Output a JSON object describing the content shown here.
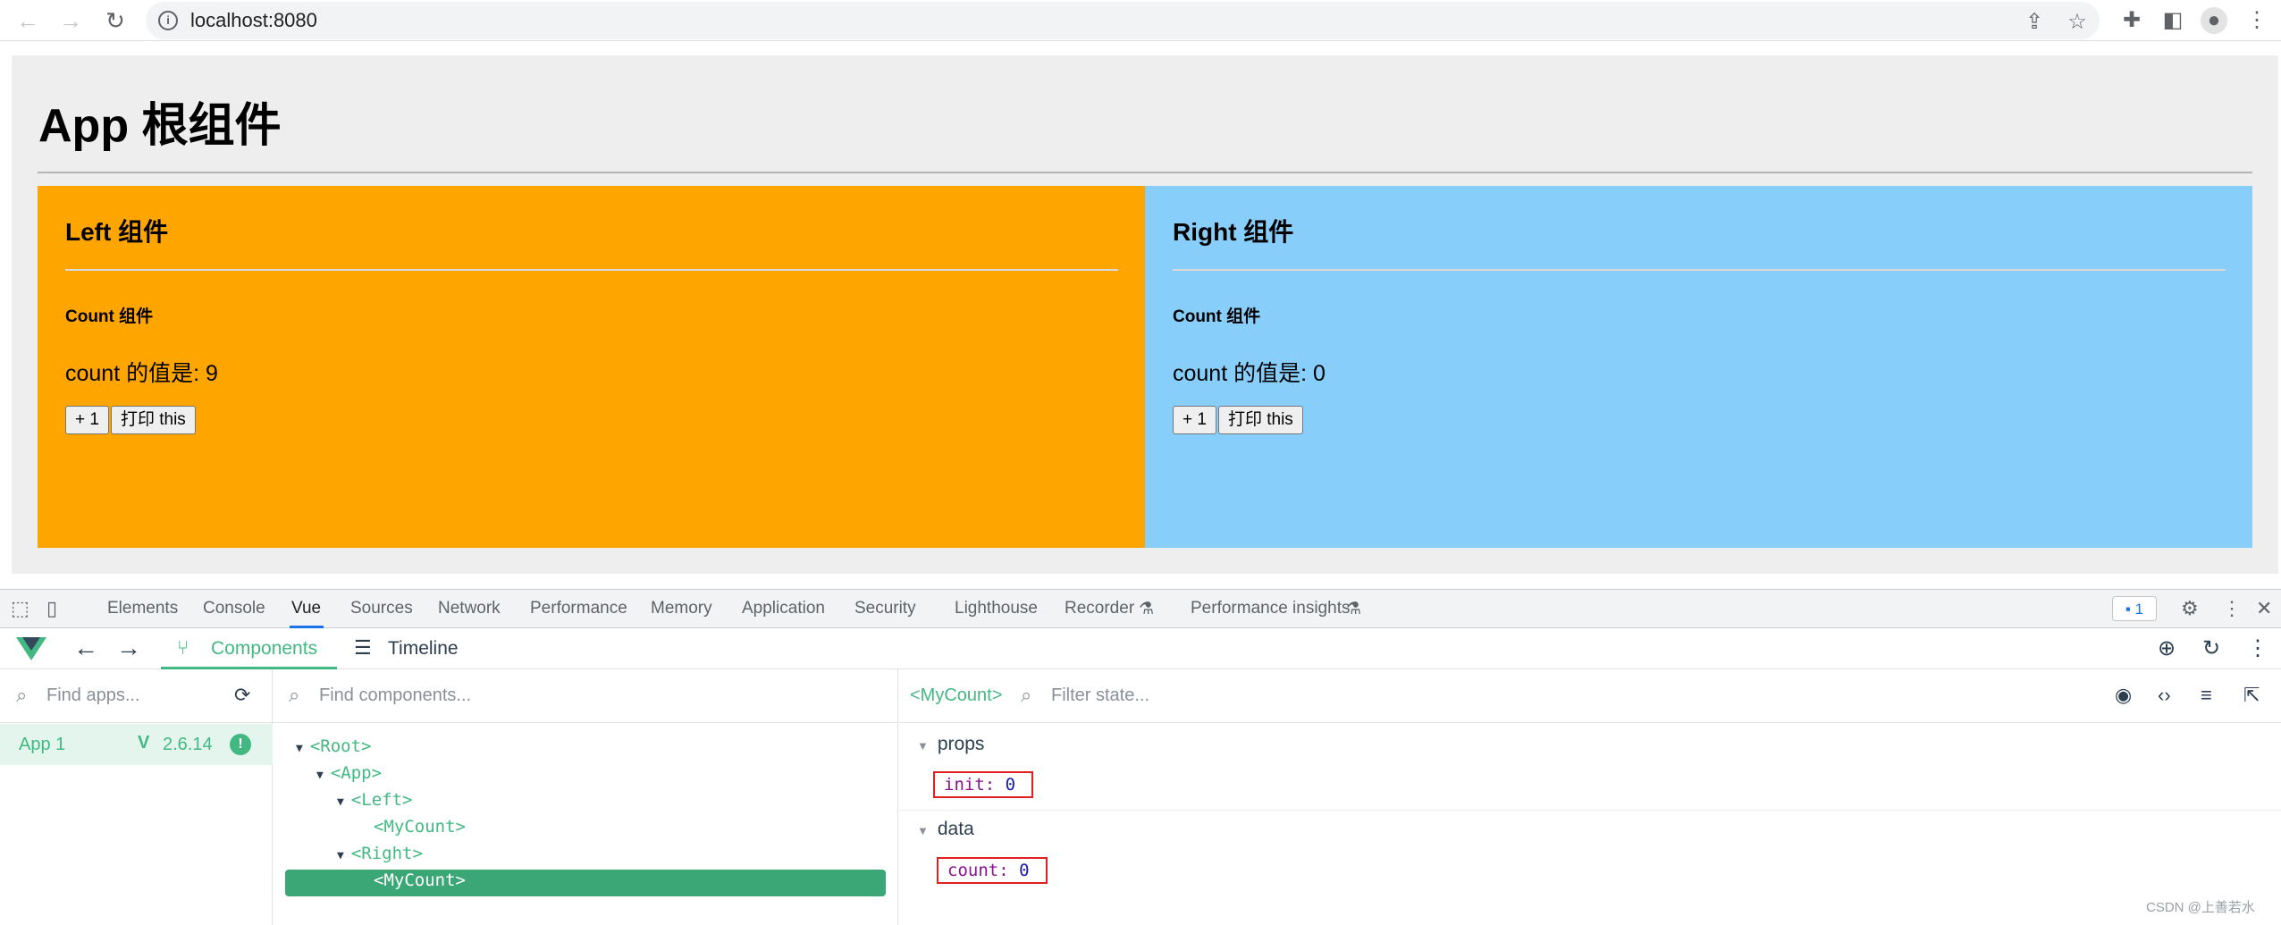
{
  "browser": {
    "url": "localhost:8080"
  },
  "page": {
    "title": "App 根组件",
    "left": {
      "title": "Left 组件",
      "count_title": "Count 组件",
      "count_text": "count 的值是: 9",
      "inc_button": "+ 1",
      "print_button": "打印 this",
      "bg_color": "#ffa500"
    },
    "right": {
      "title": "Right 组件",
      "count_title": "Count 组件",
      "count_text": "count 的值是: 0",
      "inc_button": "+ 1",
      "print_button": "打印 this",
      "bg_color": "#87cefa"
    }
  },
  "devtools": {
    "tabs": [
      "Elements",
      "Console",
      "Vue",
      "Sources",
      "Network",
      "Performance",
      "Memory",
      "Application",
      "Security",
      "Lighthouse",
      "Recorder",
      "Performance insights"
    ],
    "active_tab": "Vue",
    "issues_count": "1"
  },
  "vue": {
    "tabs": {
      "components": "Components",
      "timeline": "Timeline"
    },
    "apps_search_placeholder": "Find apps...",
    "components_search_placeholder": "Find components...",
    "state_filter_placeholder": "Filter state...",
    "app": {
      "name": "App 1",
      "version": "2.6.14"
    },
    "tree": [
      "<Root>",
      "<App>",
      "<Left>",
      "<MyCount>",
      "<Right>",
      "<MyCount>"
    ],
    "selected_component": "<MyCount>",
    "state": {
      "props_label": "props",
      "prop_key": "init",
      "prop_value": "0",
      "data_label": "data",
      "data_key": "count",
      "data_value": "0"
    },
    "accent_color": "#42b883"
  },
  "watermark": "CSDN @上善若水"
}
